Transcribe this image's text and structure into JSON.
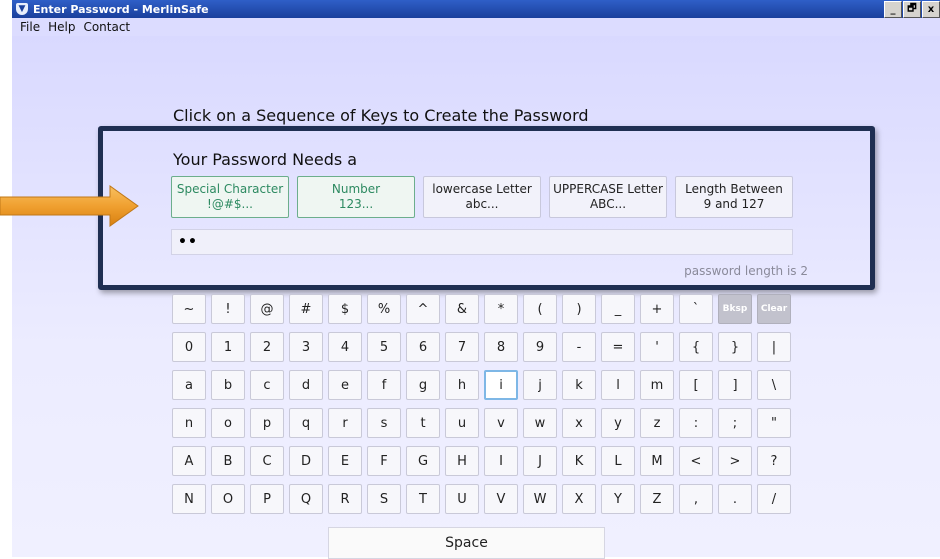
{
  "window": {
    "title": "Enter Password - MerlinSafe",
    "controls": [
      "_",
      "🗗",
      "x"
    ]
  },
  "menu": [
    "File",
    "Help",
    "Contact"
  ],
  "instruction": "Click on a Sequence of Keys to Create the Password",
  "requirements": {
    "title": "Your Password Needs a",
    "items": [
      {
        "line1": "Special Character",
        "line2": "!@#$...",
        "met": true
      },
      {
        "line1": "Number",
        "line2": "123...",
        "met": true
      },
      {
        "line1": "lowercase Letter",
        "line2": "abc...",
        "met": false
      },
      {
        "line1": "UPPERCASE Letter",
        "line2": "ABC...",
        "met": false
      },
      {
        "line1": "Length Between",
        "line2": "9 and 127",
        "met": false
      }
    ]
  },
  "password": {
    "masked": "••",
    "length_text": "password length is 2"
  },
  "keyboard": {
    "rows": [
      [
        "~",
        "!",
        "@",
        "#",
        "$",
        "%",
        "^",
        "&",
        "*",
        "(",
        ")",
        "_",
        "+",
        "`",
        "Bksp",
        "Clear"
      ],
      [
        "0",
        "1",
        "2",
        "3",
        "4",
        "5",
        "6",
        "7",
        "8",
        "9",
        "-",
        "=",
        "'",
        "{",
        "}",
        "|"
      ],
      [
        "a",
        "b",
        "c",
        "d",
        "e",
        "f",
        "g",
        "h",
        "i",
        "j",
        "k",
        "l",
        "m",
        "[",
        "]",
        "\\"
      ],
      [
        "n",
        "o",
        "p",
        "q",
        "r",
        "s",
        "t",
        "u",
        "v",
        "w",
        "x",
        "y",
        "z",
        ":",
        ";",
        "\""
      ],
      [
        "A",
        "B",
        "C",
        "D",
        "E",
        "F",
        "G",
        "H",
        "I",
        "J",
        "K",
        "L",
        "M",
        "<",
        ">",
        "?"
      ],
      [
        "N",
        "O",
        "P",
        "Q",
        "R",
        "S",
        "T",
        "U",
        "V",
        "W",
        "X",
        "Y",
        "Z",
        ",",
        ".",
        "/"
      ]
    ],
    "highlighted": "i",
    "space_label": "Space"
  },
  "colors": {
    "panel_border": "#1f2f52",
    "met": "#2d8a61",
    "arrow": "#f0a030"
  }
}
